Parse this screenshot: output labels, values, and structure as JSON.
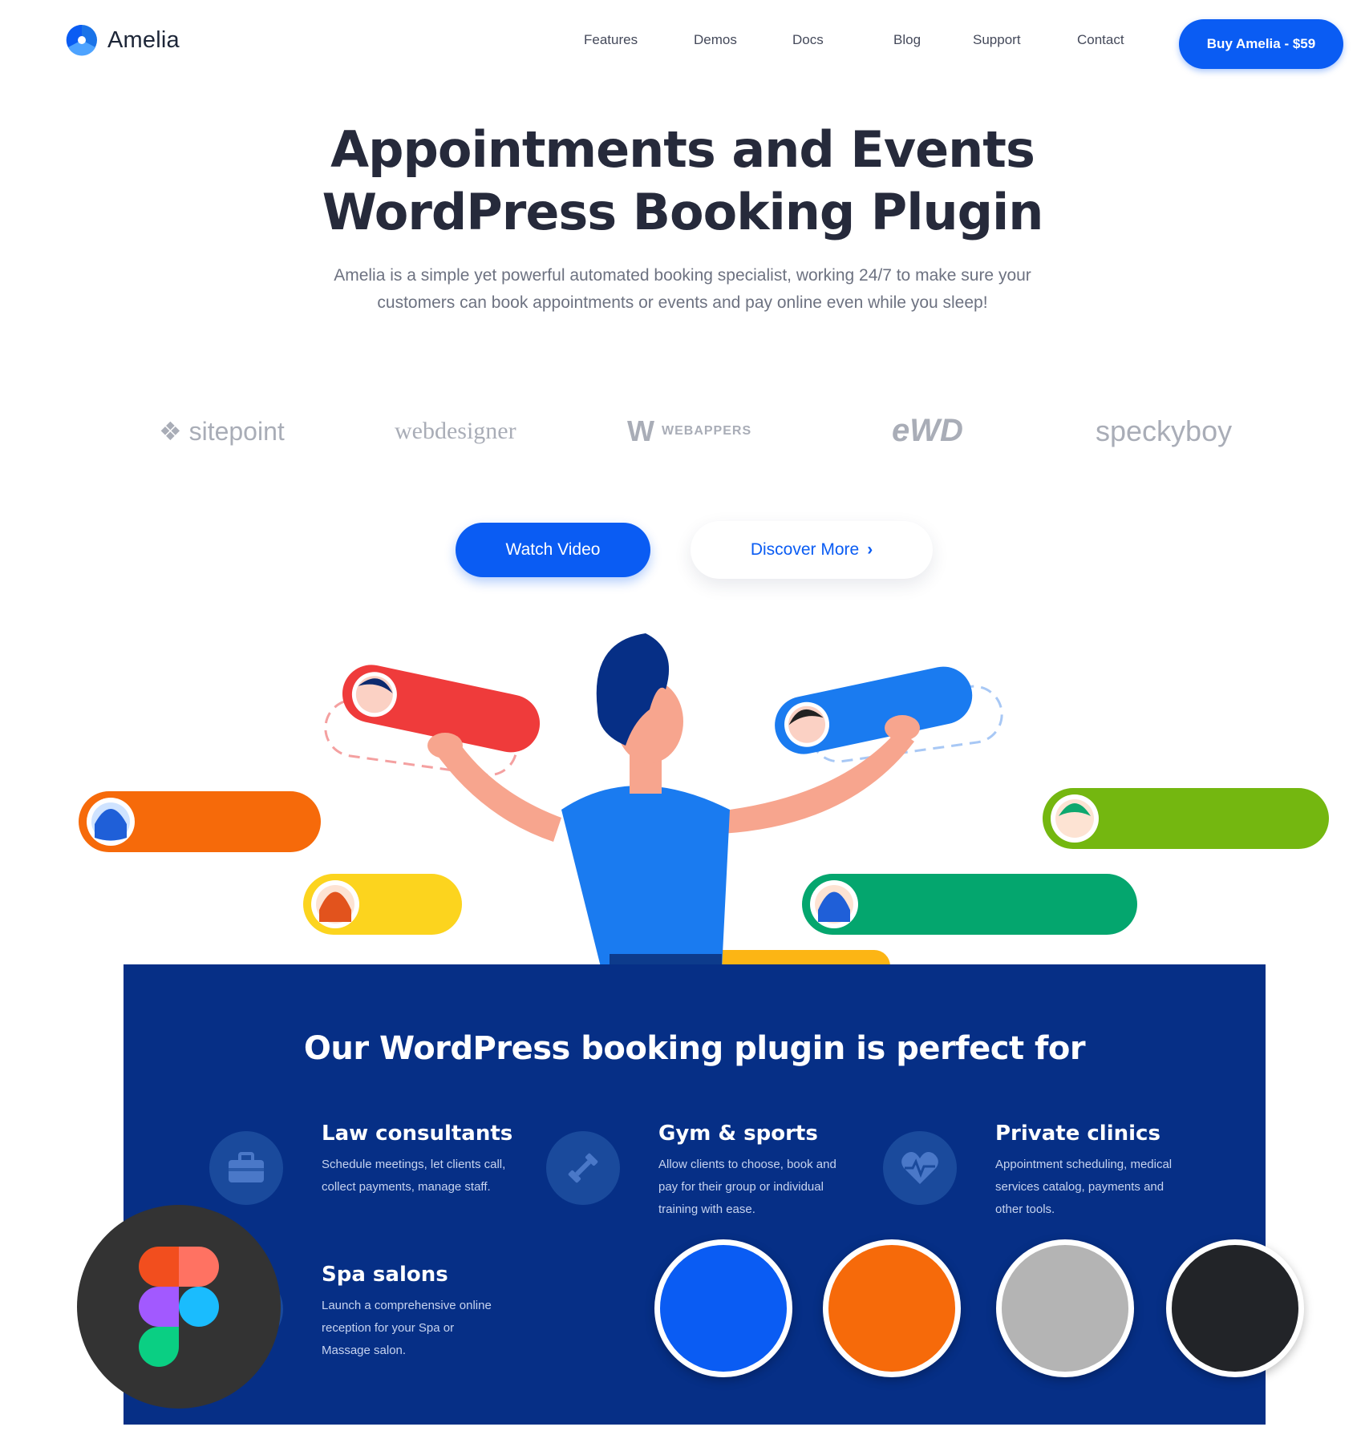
{
  "header": {
    "logo_text": "Amelia",
    "nav": [
      "Features",
      "Demos",
      "Docs",
      "Blog",
      "Support",
      "Contact"
    ],
    "buy_button": "Buy Amelia - $59"
  },
  "hero": {
    "title_line1": "Appointments and Events",
    "title_line2": "WordPress Booking Plugin",
    "subtitle": "Amelia is a simple yet powerful automated booking specialist, working 24/7 to make sure your customers can book appointments or events and pay online even while you sleep!"
  },
  "partners": [
    "sitepoint",
    "webdesigner",
    "WEBAPPERS",
    "eWD",
    "speckyboy"
  ],
  "buttons": {
    "watch_video": "Watch Video",
    "discover_more": "Discover More"
  },
  "section": {
    "title": "Our WordPress booking plugin is perfect for",
    "features": [
      {
        "title": "Law consultants",
        "text": "Schedule meetings, let clients call, collect payments, manage staff.",
        "icon": "briefcase-icon"
      },
      {
        "title": "Gym & sports",
        "text": "Allow clients to choose, book and pay for their group or individual training with ease.",
        "icon": "dumbbell-icon"
      },
      {
        "title": "Private clinics",
        "text": "Appointment scheduling, medical services catalog, payments and other tools.",
        "icon": "heartbeat-icon"
      },
      {
        "title": "Spa salons",
        "text": "Launch a comprehensive online reception for your Spa or Massage salon.",
        "icon": "tools-icon"
      }
    ]
  },
  "colors": {
    "primary": "#0a5cf3",
    "navy": "#062f86",
    "swatches": [
      "#0a5cf3",
      "#f66a0a",
      "#b4b4b4",
      "#222428"
    ]
  }
}
